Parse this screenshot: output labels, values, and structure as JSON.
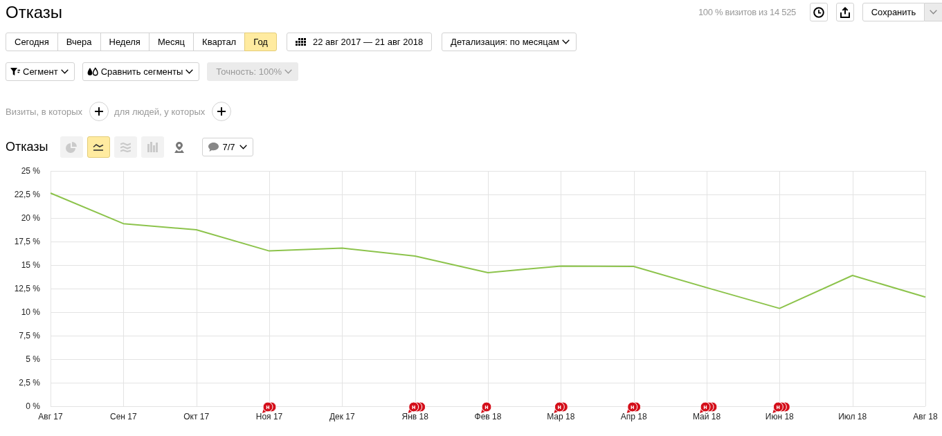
{
  "header": {
    "title": "Отказы",
    "stats": "100 % визитов из 14 525",
    "actions": [
      {
        "kind": "history"
      },
      {
        "kind": "export"
      }
    ],
    "save": {
      "label": "Сохранить"
    }
  },
  "periods": [
    {
      "label": "Сегодня",
      "selected": false
    },
    {
      "label": "Вчера",
      "selected": false
    },
    {
      "label": "Неделя",
      "selected": false
    },
    {
      "label": "Месяц",
      "selected": false
    },
    {
      "label": "Квартал",
      "selected": false
    },
    {
      "label": "Год",
      "selected": true
    }
  ],
  "date_range": {
    "label": "22 авг 2017 — 21 авг 2018"
  },
  "detail": {
    "label": "Детализация: по месяцам"
  },
  "segment_tools": [
    {
      "kind": "segment",
      "label": "Сегмент",
      "disabled": false
    },
    {
      "kind": "compare",
      "label": "Сравнить сегменты",
      "disabled": false
    },
    {
      "kind": "accuracy",
      "label": "Точность: 100%",
      "disabled": true
    }
  ],
  "conditions": [
    {
      "label": "Визиты, в которых"
    },
    {
      "label": "для людей, у которых"
    }
  ],
  "chart_panel": {
    "title": "Отказы",
    "views": [
      {
        "kind": "pie",
        "selected": false,
        "disabled": true
      },
      {
        "kind": "line",
        "selected": true,
        "disabled": false
      },
      {
        "kind": "area",
        "selected": false,
        "disabled": true
      },
      {
        "kind": "bar",
        "selected": false,
        "disabled": true
      },
      {
        "kind": "map",
        "selected": false,
        "disabled": false
      }
    ],
    "notes": {
      "label": "7/7"
    },
    "chart_data": {
      "type": "line",
      "grid": true,
      "categories": [
        "Авг 17",
        "Сен 17",
        "Окт 17",
        "Ноя 17",
        "Дек 17",
        "Янв 18",
        "Фев 18",
        "Мар 18",
        "Апр 18",
        "Май 18",
        "Июн 18",
        "Июл 18",
        "Авг 18"
      ],
      "series": [
        {
          "color": "#8cc34b",
          "values": [
            22.65,
            19.4,
            18.75,
            16.5,
            16.8,
            15.95,
            14.2,
            14.9,
            14.85,
            12.6,
            10.4,
            13.9,
            11.6
          ]
        }
      ],
      "ylim": [
        0,
        25
      ],
      "yticks": [
        {
          "value": 0,
          "label": "0 %"
        },
        {
          "value": 2.5,
          "label": "2,5 %"
        },
        {
          "value": 5,
          "label": "5 %"
        },
        {
          "value": 7.5,
          "label": "7,5 %"
        },
        {
          "value": 10,
          "label": "10 %"
        },
        {
          "value": 12.5,
          "label": "12,5 %"
        },
        {
          "value": 15,
          "label": "15 %"
        },
        {
          "value": 17.5,
          "label": "17,5 %"
        },
        {
          "value": 20,
          "label": "20 %"
        },
        {
          "value": 22.5,
          "label": "22,5 %"
        },
        {
          "value": 25,
          "label": "25 %"
        }
      ]
    },
    "axis_notes": [
      {
        "notes": false
      },
      {
        "notes": false
      },
      {
        "notes": false
      },
      {
        "notes": true,
        "markers": [
          {
            "kind": "front",
            "text": "н"
          },
          {
            "kind": "stacked"
          }
        ]
      },
      {
        "notes": false
      },
      {
        "notes": true,
        "markers": [
          {
            "kind": "front",
            "text": "н"
          },
          {
            "kind": "stacked"
          },
          {
            "kind": "stacked"
          }
        ]
      },
      {
        "notes": true,
        "markers": [
          {
            "kind": "front",
            "text": "н"
          }
        ]
      },
      {
        "notes": true,
        "markers": [
          {
            "kind": "front",
            "text": "н"
          },
          {
            "kind": "stacked"
          }
        ]
      },
      {
        "notes": true,
        "markers": [
          {
            "kind": "front",
            "text": "н"
          },
          {
            "kind": "stacked"
          }
        ]
      },
      {
        "notes": true,
        "markers": [
          {
            "kind": "front",
            "text": "н"
          },
          {
            "kind": "stacked"
          },
          {
            "kind": "stacked"
          }
        ]
      },
      {
        "notes": true,
        "markers": [
          {
            "kind": "front",
            "text": "н"
          },
          {
            "kind": "stacked"
          },
          {
            "kind": "stacked"
          }
        ]
      },
      {
        "notes": false
      },
      {
        "notes": false
      }
    ]
  }
}
